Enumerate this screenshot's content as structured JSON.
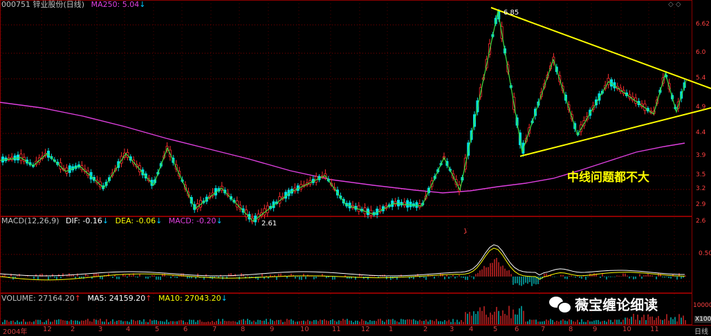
{
  "header": {
    "stock": "000751 锌业股份(日线)",
    "ma250_label": "MA250:",
    "ma250_value": "5.04",
    "ma250_arrow": "↓"
  },
  "macd": {
    "name": "MACD(12,26,9)",
    "dif_label": "DIF:",
    "dif_value": "-0.16",
    "dif_arrow": "↓",
    "dea_label": "DEA:",
    "dea_value": "-0.06",
    "dea_arrow": "↓",
    "macd_label": "MACD:",
    "macd_value": "-0.20",
    "macd_arrow": "↓"
  },
  "volume": {
    "vol_label": "VOLUME:",
    "vol_value": "27164.20",
    "vol_arrow": "↑",
    "ma5_label": "MA5:",
    "ma5_value": "24159.20",
    "ma5_arrow": "↑",
    "ma10_label": "MA10:",
    "ma10_value": "27043.20",
    "ma10_arrow": "↓"
  },
  "annotations": {
    "high_label": "6.85",
    "low_label": "2.61",
    "text": "中线问题都不大",
    "watermark": "薇宝缠论细读"
  },
  "price_axis": [
    "6.62",
    "6.0",
    "5.4",
    "4.9",
    "4.4",
    "3.9",
    "3.5",
    "3.2",
    "2.9",
    "2.6"
  ],
  "macd_axis": [
    "0.50"
  ],
  "vol_axis": [
    "10000",
    "X100"
  ],
  "x_axis": [
    "2004年",
    "12",
    "2",
    "3",
    "4",
    "5",
    "6",
    "7",
    "8",
    "9",
    "10",
    "11",
    "12",
    "1",
    "2",
    "3",
    "4",
    "5",
    "6",
    "7",
    "8",
    "9",
    "10",
    "11",
    "日线"
  ],
  "colors": {
    "up": "#ff3030",
    "down": "#00e0e0",
    "ma250": "#e040e0",
    "zigzag": "#40e040",
    "trendline": "#ffff00",
    "grid": "#8b0000"
  }
}
